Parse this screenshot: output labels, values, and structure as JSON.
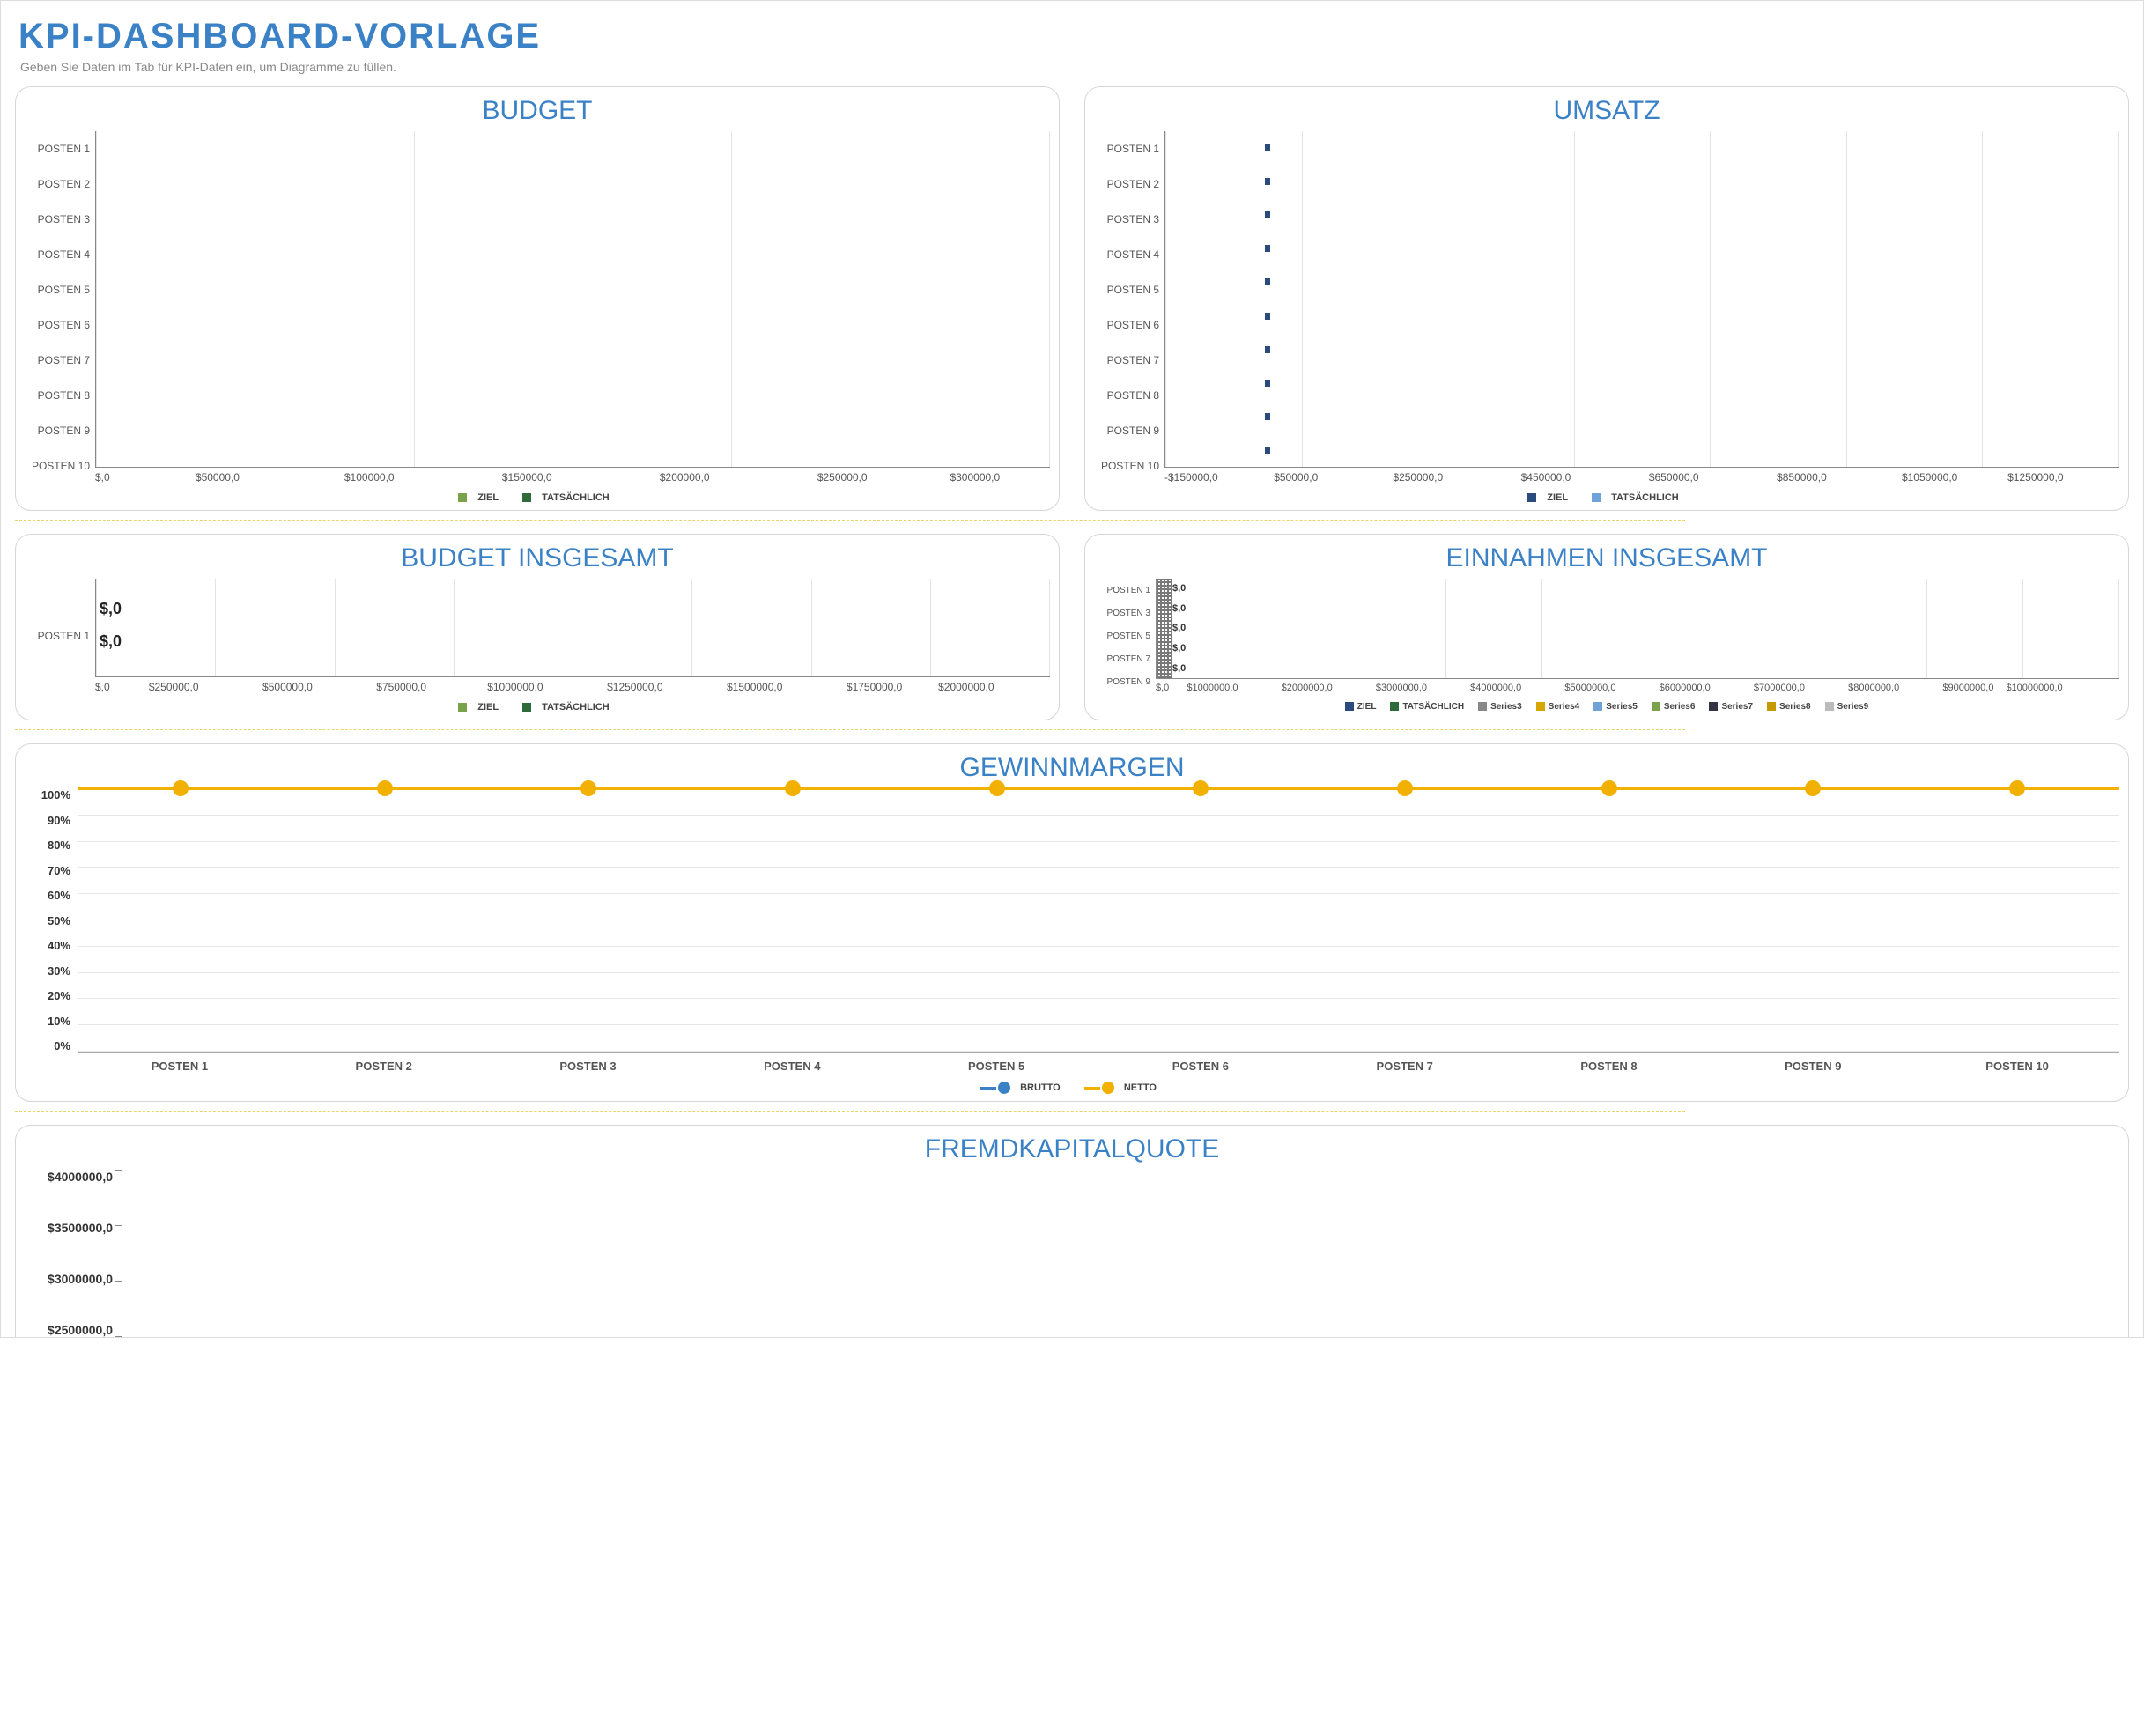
{
  "page": {
    "title": "KPI-DASHBOARD-VORLAGE",
    "subtitle": "Geben Sie Daten im Tab für KPI-Daten ein, um Diagramme zu füllen."
  },
  "colors": {
    "title": "#3a81c6",
    "ziel_budget": "#7aa24a",
    "tats_budget": "#2f6b3a",
    "ziel_umsatz": "#2a4b7c",
    "tats_umsatz": "#6fa3d8",
    "netto": "#f2b100",
    "brutto": "#3a81c6"
  },
  "legend_labels": {
    "ziel": "ZIEL",
    "tats": "TATSÄCHLICH",
    "brutto": "BRUTTO",
    "netto": "NETTO",
    "series3": "Series3",
    "series4": "Series4",
    "series5": "Series5",
    "series6": "Series6",
    "series7": "Series7",
    "series8": "Series8",
    "series9": "Series9"
  },
  "chart_data": [
    {
      "id": "budget",
      "type": "bar",
      "orientation": "horizontal",
      "title": "BUDGET",
      "categories": [
        "POSTEN 1",
        "POSTEN 2",
        "POSTEN 3",
        "POSTEN 4",
        "POSTEN 5",
        "POSTEN 6",
        "POSTEN 7",
        "POSTEN 8",
        "POSTEN 9",
        "POSTEN 10"
      ],
      "series": [
        {
          "name": "ZIEL",
          "values": [
            0,
            0,
            0,
            0,
            0,
            0,
            0,
            0,
            0,
            0
          ]
        },
        {
          "name": "TATSÄCHLICH",
          "values": [
            0,
            0,
            0,
            0,
            0,
            0,
            0,
            0,
            0,
            0
          ]
        }
      ],
      "xlim": [
        0,
        300000
      ],
      "x_ticks": [
        "$,0",
        "$50000,0",
        "$100000,0",
        "$150000,0",
        "$200000,0",
        "$250000,0",
        "$300000,0"
      ]
    },
    {
      "id": "umsatz",
      "type": "bar",
      "orientation": "horizontal",
      "title": "UMSATZ",
      "categories": [
        "POSTEN 1",
        "POSTEN 2",
        "POSTEN 3",
        "POSTEN 4",
        "POSTEN 5",
        "POSTEN 6",
        "POSTEN 7",
        "POSTEN 8",
        "POSTEN 9",
        "POSTEN 10"
      ],
      "series": [
        {
          "name": "ZIEL",
          "values": [
            0,
            0,
            0,
            0,
            0,
            0,
            0,
            0,
            0,
            0
          ]
        },
        {
          "name": "TATSÄCHLICH",
          "values": [
            0,
            0,
            0,
            0,
            0,
            0,
            0,
            0,
            0,
            0
          ]
        }
      ],
      "xlim": [
        -150000,
        1250000
      ],
      "x_ticks": [
        "-$150000,0",
        "$50000,0",
        "$250000,0",
        "$450000,0",
        "$650000,0",
        "$850000,0",
        "$1050000,0",
        "$1250000,0"
      ]
    },
    {
      "id": "budget_total",
      "type": "bar",
      "orientation": "horizontal",
      "title": "BUDGET INSGESAMT",
      "categories": [
        "POSTEN 1"
      ],
      "series": [
        {
          "name": "ZIEL",
          "values": [
            0
          ]
        },
        {
          "name": "TATSÄCHLICH",
          "values": [
            0
          ]
        }
      ],
      "value_labels": [
        "$,0",
        "$,0"
      ],
      "xlim": [
        0,
        2000000
      ],
      "x_ticks": [
        "$,0",
        "$250000,0",
        "$500000,0",
        "$750000,0",
        "$1000000,0",
        "$1250000,0",
        "$1500000,0",
        "$1750000,0",
        "$2000000,0"
      ]
    },
    {
      "id": "einnahmen_total",
      "type": "bar",
      "orientation": "horizontal",
      "title": "EINNAHMEN INSGESAMT",
      "categories": [
        "POSTEN 1",
        "POSTEN 3",
        "POSTEN 5",
        "POSTEN 7",
        "POSTEN 9"
      ],
      "series": [
        {
          "name": "ZIEL",
          "values": [
            0,
            0,
            0,
            0,
            0
          ]
        },
        {
          "name": "TATSÄCHLICH",
          "values": [
            0,
            0,
            0,
            0,
            0
          ]
        },
        {
          "name": "Series3",
          "values": [
            0,
            0,
            0,
            0,
            0
          ]
        },
        {
          "name": "Series4",
          "values": [
            0,
            0,
            0,
            0,
            0
          ]
        },
        {
          "name": "Series5",
          "values": [
            0,
            0,
            0,
            0,
            0
          ]
        },
        {
          "name": "Series6",
          "values": [
            0,
            0,
            0,
            0,
            0
          ]
        },
        {
          "name": "Series7",
          "values": [
            0,
            0,
            0,
            0,
            0
          ]
        },
        {
          "name": "Series8",
          "values": [
            0,
            0,
            0,
            0,
            0
          ]
        },
        {
          "name": "Series9",
          "values": [
            0,
            0,
            0,
            0,
            0
          ]
        }
      ],
      "xlim": [
        0,
        10000000
      ],
      "x_ticks": [
        "$,0",
        "$1000000,0",
        "$2000000,0",
        "$3000000,0",
        "$4000000,0",
        "$5000000,0",
        "$6000000,0",
        "$7000000,0",
        "$8000000,0",
        "$9000000,0",
        "$10000000,0"
      ]
    },
    {
      "id": "gewinnmargen",
      "type": "line",
      "title": "GEWINNMARGEN",
      "categories": [
        "POSTEN 1",
        "POSTEN 2",
        "POSTEN 3",
        "POSTEN 4",
        "POSTEN 5",
        "POSTEN 6",
        "POSTEN 7",
        "POSTEN 8",
        "POSTEN 9",
        "POSTEN 10"
      ],
      "series": [
        {
          "name": "BRUTTO",
          "values": [
            null,
            null,
            null,
            null,
            null,
            null,
            null,
            null,
            null,
            null
          ]
        },
        {
          "name": "NETTO",
          "values": [
            100,
            100,
            100,
            100,
            100,
            100,
            100,
            100,
            100,
            100
          ]
        }
      ],
      "ylim": [
        0,
        100
      ],
      "y_ticks": [
        "100%",
        "90%",
        "80%",
        "70%",
        "60%",
        "50%",
        "40%",
        "30%",
        "20%",
        "10%",
        "0%"
      ]
    },
    {
      "id": "fremdkapitalquote",
      "type": "bar",
      "orientation": "vertical",
      "title": "FREMDKAPITALQUOTE",
      "categories": [],
      "series": [],
      "ylim": [
        0,
        4000000
      ],
      "y_ticks": [
        "$4000000,0",
        "$3500000,0",
        "$3000000,0",
        "$2500000,0"
      ]
    }
  ]
}
